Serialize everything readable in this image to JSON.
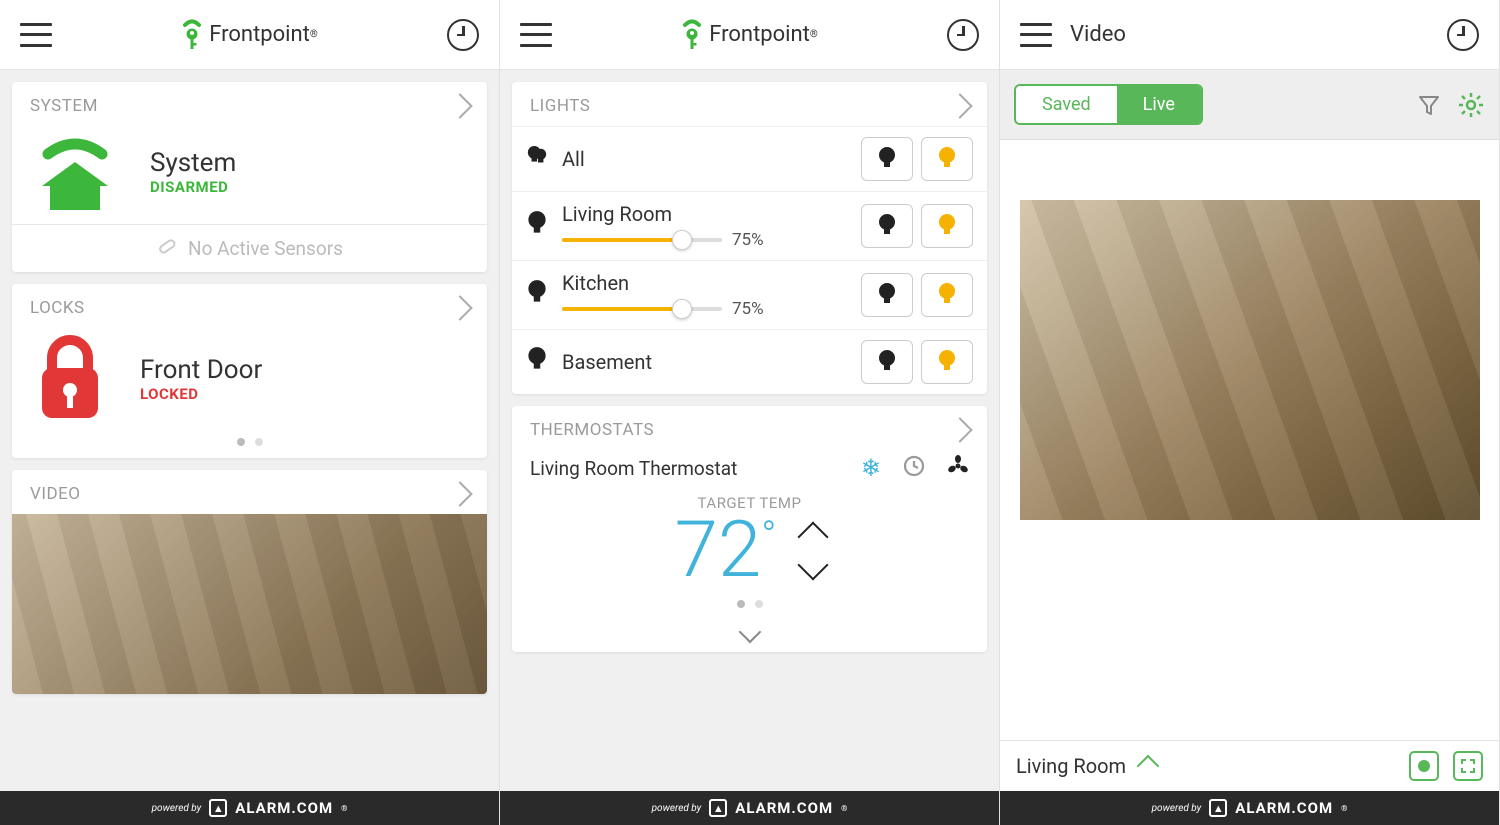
{
  "brand": "Frontpoint",
  "footer": {
    "pb": "powered by",
    "name": "ALARM.COM"
  },
  "s1": {
    "system": {
      "title": "SYSTEM",
      "label": "System",
      "status": "DISARMED",
      "sensors": "No Active Sensors"
    },
    "locks": {
      "title": "LOCKS",
      "label": "Front Door",
      "status": "LOCKED"
    },
    "video": {
      "title": "VIDEO"
    }
  },
  "s2": {
    "lights": {
      "title": "LIGHTS",
      "rows": [
        {
          "name": "All"
        },
        {
          "name": "Living Room",
          "pct": "75%"
        },
        {
          "name": "Kitchen",
          "pct": "75%"
        },
        {
          "name": "Basement"
        }
      ]
    },
    "therm": {
      "title": "THERMOSTATS",
      "name": "Living Room Thermostat",
      "target_label": "TARGET TEMP",
      "temp": "72",
      "deg": "°"
    }
  },
  "s3": {
    "title": "Video",
    "tabs": {
      "saved": "Saved",
      "live": "Live"
    },
    "camera": "Living Room"
  }
}
